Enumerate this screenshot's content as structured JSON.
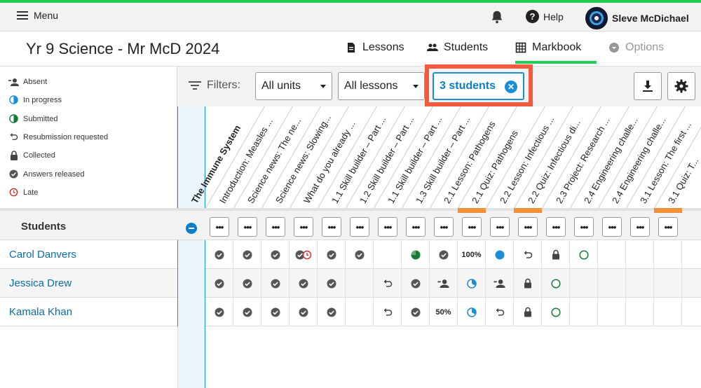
{
  "topbar": {
    "menu_label": "Menu",
    "help_label": "Help",
    "user_name": "Sleve McDichael"
  },
  "header": {
    "course_title": "Yr 9 Science - Mr McD 2024",
    "tabs": [
      {
        "label": "Lessons",
        "icon": "document-icon"
      },
      {
        "label": "Students",
        "icon": "people-icon"
      },
      {
        "label": "Markbook",
        "icon": "grid-icon"
      },
      {
        "label": "Options",
        "icon": "chevron-circle-icon"
      }
    ]
  },
  "legend": [
    {
      "label": "Absent",
      "icon": "absent-icon"
    },
    {
      "label": "In progress",
      "icon": "in-progress-icon"
    },
    {
      "label": "Submitted",
      "icon": "submitted-icon"
    },
    {
      "label": "Resubmission requested",
      "icon": "resubmission-icon"
    },
    {
      "label": "Collected",
      "icon": "lock-icon"
    },
    {
      "label": "Answers released",
      "icon": "check-icon"
    },
    {
      "label": "Late",
      "icon": "late-icon"
    }
  ],
  "toolbar": {
    "filters_label": "Filters:",
    "unit_select": "All units",
    "lesson_select": "All lessons",
    "student_chip": "3 students",
    "download_icon": "download-icon",
    "settings_icon": "gear-icon"
  },
  "columns": {
    "unit": "The Immune System",
    "items": [
      "Introduction: Measles ...",
      "Science news: The ne...",
      "Science news: Slowing...",
      "What do you already ...",
      "1.1 Skill builder – Part ...",
      "1.2 Skill builder – Part ...",
      "1.1 Skill builder – Part ...",
      "1.3 Skill builder – Part ...",
      "2.1 Lesson: Pathogens",
      "2.1 Quiz: Pathogens",
      "2.2 Lesson: Infectious ...",
      "2.2 Quiz: Infectious di...",
      "2.3 Project: Research ...",
      "2.4 Engineering challe...",
      "2.4 Engineering challe...",
      "3.1 Lesson: The first ...",
      "3.1 Quiz: T..."
    ],
    "dots_label": "•••"
  },
  "students_header": "Students",
  "students": [
    {
      "name": "Carol Danvers",
      "cells": [
        "check",
        "check",
        "check",
        "check-late",
        "check",
        "check",
        "",
        "done-pie",
        "check",
        "100%",
        "dot-blue",
        "resub",
        "lock",
        "circle-green",
        "",
        "",
        ""
      ]
    },
    {
      "name": "Jessica Drew",
      "cells": [
        "check",
        "check",
        "check",
        "check",
        "check",
        "",
        "resub",
        "check",
        "absent",
        "progress-pie",
        "absent",
        "lock",
        "circle-green",
        "",
        "",
        "",
        ""
      ]
    },
    {
      "name": "Kamala Khan",
      "cells": [
        "check",
        "check",
        "check",
        "check",
        "check",
        "",
        "resub",
        "check",
        "50%",
        "progress-pie",
        "resub",
        "lock",
        "circle-green",
        "",
        "",
        "",
        ""
      ]
    }
  ],
  "colors": {
    "accent_green": "#22cc55",
    "link_blue": "#0a6ea8",
    "chip_blue": "#1a8ed6",
    "highlight_red": "#f15a3c",
    "orange": "#f0913a"
  }
}
